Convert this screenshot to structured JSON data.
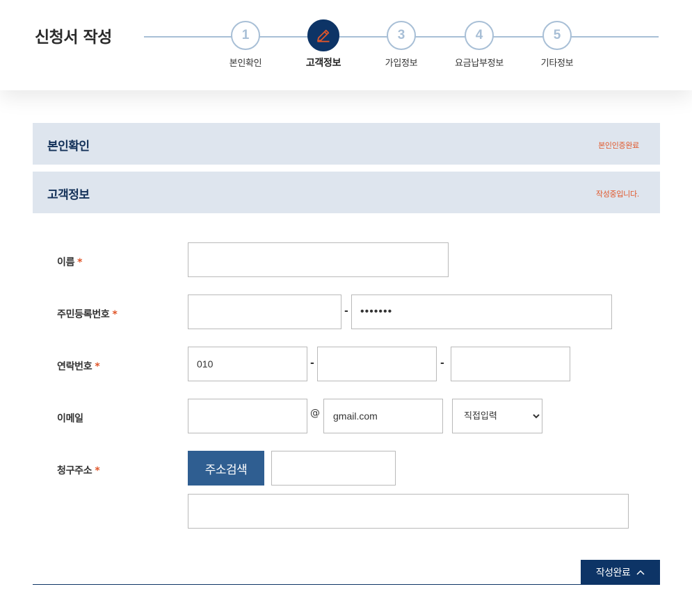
{
  "header": {
    "title": "신청서 작성",
    "steps": [
      {
        "number": "1",
        "label": "본인확인"
      },
      {
        "number": "",
        "label": "고객정보",
        "icon": "pencil-icon"
      },
      {
        "number": "3",
        "label": "가입정보"
      },
      {
        "number": "4",
        "label": "요금납부정보"
      },
      {
        "number": "5",
        "label": "기타정보"
      }
    ],
    "active_step": 2
  },
  "sections": {
    "identity": {
      "title": "본인확인",
      "status": "본인인증완료"
    },
    "customer": {
      "title": "고객정보",
      "status": "작성중입니다."
    }
  },
  "form": {
    "name": {
      "label": "이름",
      "required_mark": "*",
      "value": ""
    },
    "resident_number": {
      "label": "주민등록번호",
      "required_mark": "*",
      "front": "",
      "separator": "-",
      "back": "•••••••"
    },
    "phone": {
      "label": "연락번호",
      "required_mark": "*",
      "part1": "010",
      "separator1": "-",
      "part2": "",
      "separator2": "-",
      "part3": ""
    },
    "email": {
      "label": "이메일",
      "id": "",
      "at": "@",
      "domain": "gmail.com",
      "domain_select": "직접입력"
    },
    "address": {
      "label": "청구주소",
      "required_mark": "*",
      "search_button": "주소검색",
      "zip": "",
      "detail": ""
    }
  },
  "footer": {
    "done_button": "작성완료",
    "done_icon": "chevron-up-icon"
  },
  "colors": {
    "navy": "#0d3466",
    "accent": "#e0562a",
    "step_inactive": "#a8bfd6",
    "section_bg": "#dee5ee",
    "button_blue": "#2f5e91"
  }
}
